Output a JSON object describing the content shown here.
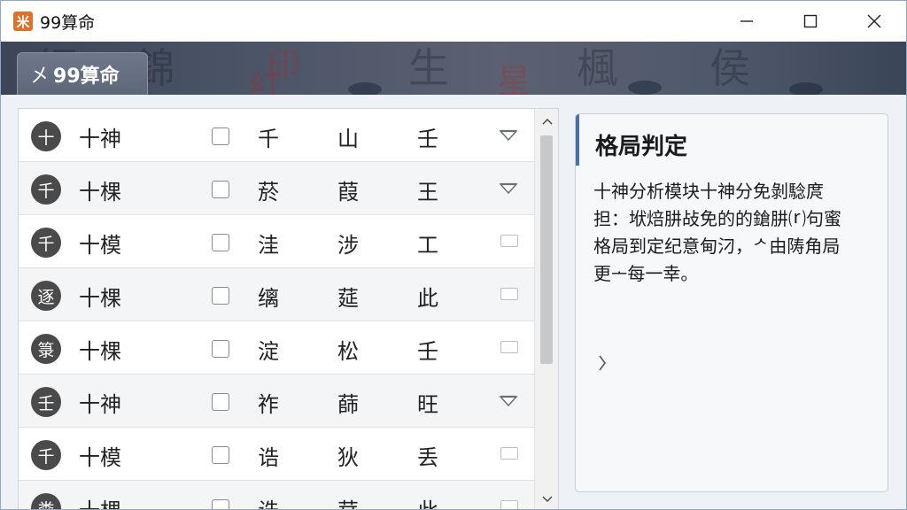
{
  "window": {
    "title": "99算命",
    "app_icon": "app-logo-icon",
    "app_icon_char": "⽶",
    "accent": "#e0712a",
    "controls": [
      "minimize-icon",
      "maximize-icon",
      "close-icon"
    ]
  },
  "banner": {
    "brand_mark": "㐅",
    "brand_label": "99算命",
    "decor_chars": [
      "師",
      "錦",
      "生",
      "楓",
      "侯"
    ],
    "seal_chars": [
      "印",
      "星",
      "紅"
    ]
  },
  "list": {
    "rows": [
      {
        "badge": "十",
        "label": "十神",
        "c1": "千",
        "c2": "山",
        "c3": "壬",
        "indicator": "chevron"
      },
      {
        "badge": "千",
        "label": "十棵",
        "c1": "菸",
        "c2": "葭",
        "c3": "王",
        "indicator": "chevron"
      },
      {
        "badge": "千",
        "label": "十模",
        "c1": "洼",
        "c2": "涉",
        "c3": "工",
        "indicator": "box"
      },
      {
        "badge": "逐",
        "label": "十棵",
        "c1": "缡",
        "c2": "莚",
        "c3": "此",
        "indicator": "box"
      },
      {
        "badge": "箓",
        "label": "十棵",
        "c1": "淀",
        "c2": "松",
        "c3": "壬",
        "indicator": "box"
      },
      {
        "badge": "壬",
        "label": "十神",
        "c1": "祚",
        "c2": "蒒",
        "c3": "旺",
        "indicator": "chevron"
      },
      {
        "badge": "千",
        "label": "十模",
        "c1": "诰",
        "c2": "狄",
        "c3": "丢",
        "indicator": "box"
      },
      {
        "badge": "粪",
        "label": "十棵",
        "c1": "诰",
        "c2": "茸",
        "c3": "此",
        "indicator": "box"
      }
    ]
  },
  "info": {
    "title": "格局判定",
    "lines": [
      "十神分析模块十神分免剝騐庹",
      "担：垘焙肼敁免的的鎗肼⒭句蜜",
      "格局到定纪意甸汈，ᄼ由陦角局",
      "更ᅩ每一幸。"
    ],
    "arrow_icon": "chevron-right-icon"
  }
}
